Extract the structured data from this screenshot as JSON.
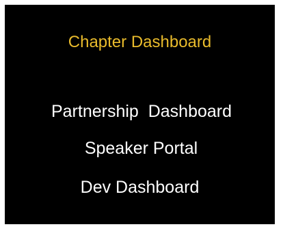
{
  "menu": {
    "active_color": "#e9bb2c",
    "text_color": "#ffffff",
    "background": "#000000",
    "items": [
      {
        "label": "Chapter Dashboard"
      },
      {
        "label": "Partnership  Dashboard"
      },
      {
        "label": "Speaker Portal"
      },
      {
        "label": "Dev Dashboard"
      }
    ]
  }
}
